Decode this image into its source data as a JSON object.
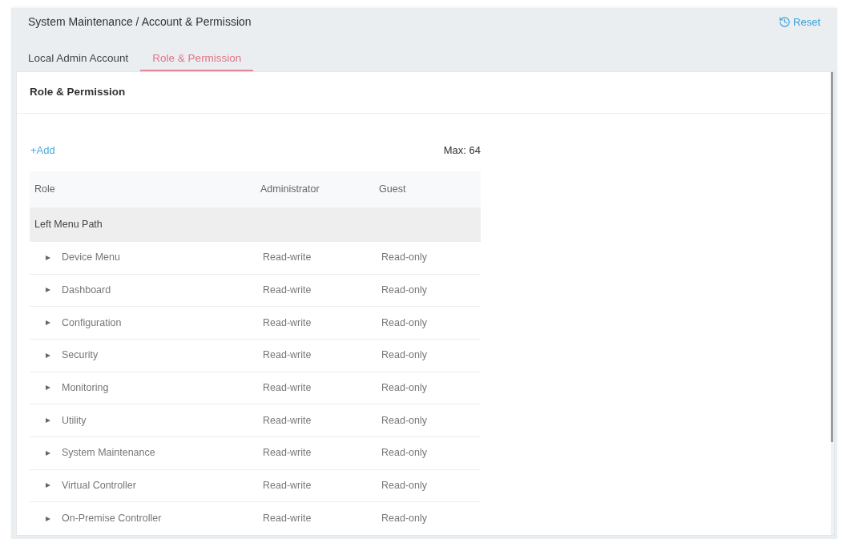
{
  "breadcrumb": "System Maintenance / Account & Permission",
  "reset_button": {
    "label": "Reset"
  },
  "tabs": [
    {
      "label": "Local Admin Account",
      "selected": false
    },
    {
      "label": "Role & Permission",
      "selected": true
    }
  ],
  "panel": {
    "title": "Role & Permission",
    "add_button": {
      "label": "+Add"
    },
    "max_label": "Max: 64",
    "table": {
      "columns": [
        "Role",
        "Administrator",
        "Guest"
      ],
      "group_row": "Left Menu Path",
      "rows": [
        {
          "role": "Device Menu",
          "expanded": false,
          "administrator": "Read-write",
          "guest": "Read-only"
        },
        {
          "role": "Dashboard",
          "expanded": false,
          "administrator": "Read-write",
          "guest": "Read-only"
        },
        {
          "role": "Configuration",
          "expanded": false,
          "administrator": "Read-write",
          "guest": "Read-only"
        },
        {
          "role": "Security",
          "expanded": false,
          "administrator": "Read-write",
          "guest": "Read-only"
        },
        {
          "role": "Monitoring",
          "expanded": false,
          "administrator": "Read-write",
          "guest": "Read-only"
        },
        {
          "role": "Utility",
          "expanded": false,
          "administrator": "Read-write",
          "guest": "Read-only"
        },
        {
          "role": "System Maintenance",
          "expanded": false,
          "administrator": "Read-write",
          "guest": "Read-only"
        },
        {
          "role": "Virtual Controller",
          "expanded": false,
          "administrator": "Read-write",
          "guest": "Read-only"
        },
        {
          "role": "On-Premise Controller",
          "expanded": false,
          "administrator": "Read-write",
          "guest": "Read-only"
        }
      ]
    }
  }
}
